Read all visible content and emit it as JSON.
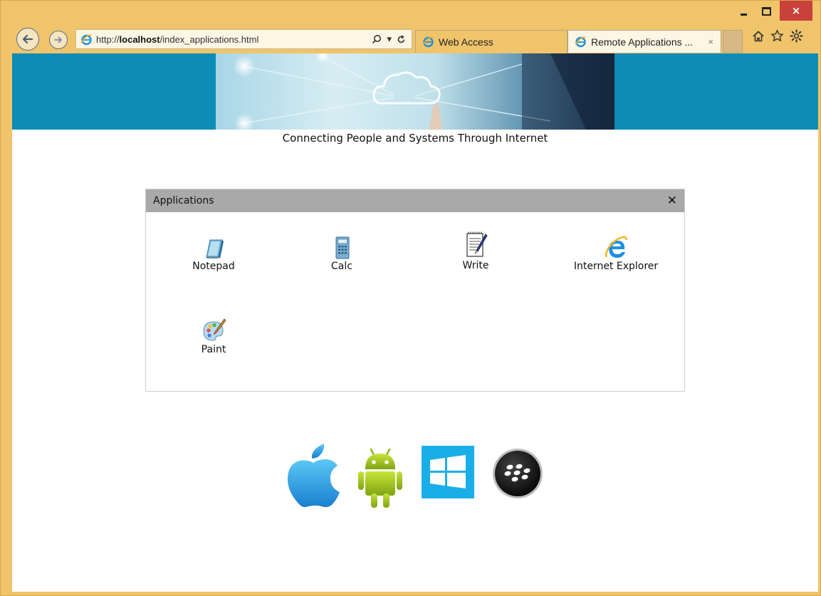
{
  "browser": {
    "address": {
      "scheme_host_prefix": "http://",
      "host": "localhost",
      "path": "/index_applications.html"
    },
    "tabs": [
      {
        "label": "Web Access"
      },
      {
        "label": "Remote Applications ..."
      }
    ],
    "window_controls": {
      "close": "×"
    },
    "tab_close": "×",
    "address_tools": {
      "search": "search-icon",
      "dropdown": "▾",
      "refresh": "refresh-icon"
    }
  },
  "page": {
    "tagline": "Connecting People and Systems Through Internet",
    "panel": {
      "title": "Applications",
      "close": "✕",
      "apps": [
        {
          "label": "Notepad",
          "icon": "notepad-icon"
        },
        {
          "label": "Calc",
          "icon": "calculator-icon"
        },
        {
          "label": "Write",
          "icon": "write-icon"
        },
        {
          "label": "Internet Explorer",
          "icon": "internet-explorer-icon"
        },
        {
          "label": "Paint",
          "icon": "paint-icon"
        }
      ]
    },
    "platforms": [
      "apple-logo",
      "android-logo",
      "windows-logo",
      "blackberry-logo"
    ]
  },
  "colors": {
    "frame": "#f0c46b",
    "banner": "#0d8cb5",
    "panel_header": "#a9a9a9",
    "close_button": "#c8413a"
  }
}
